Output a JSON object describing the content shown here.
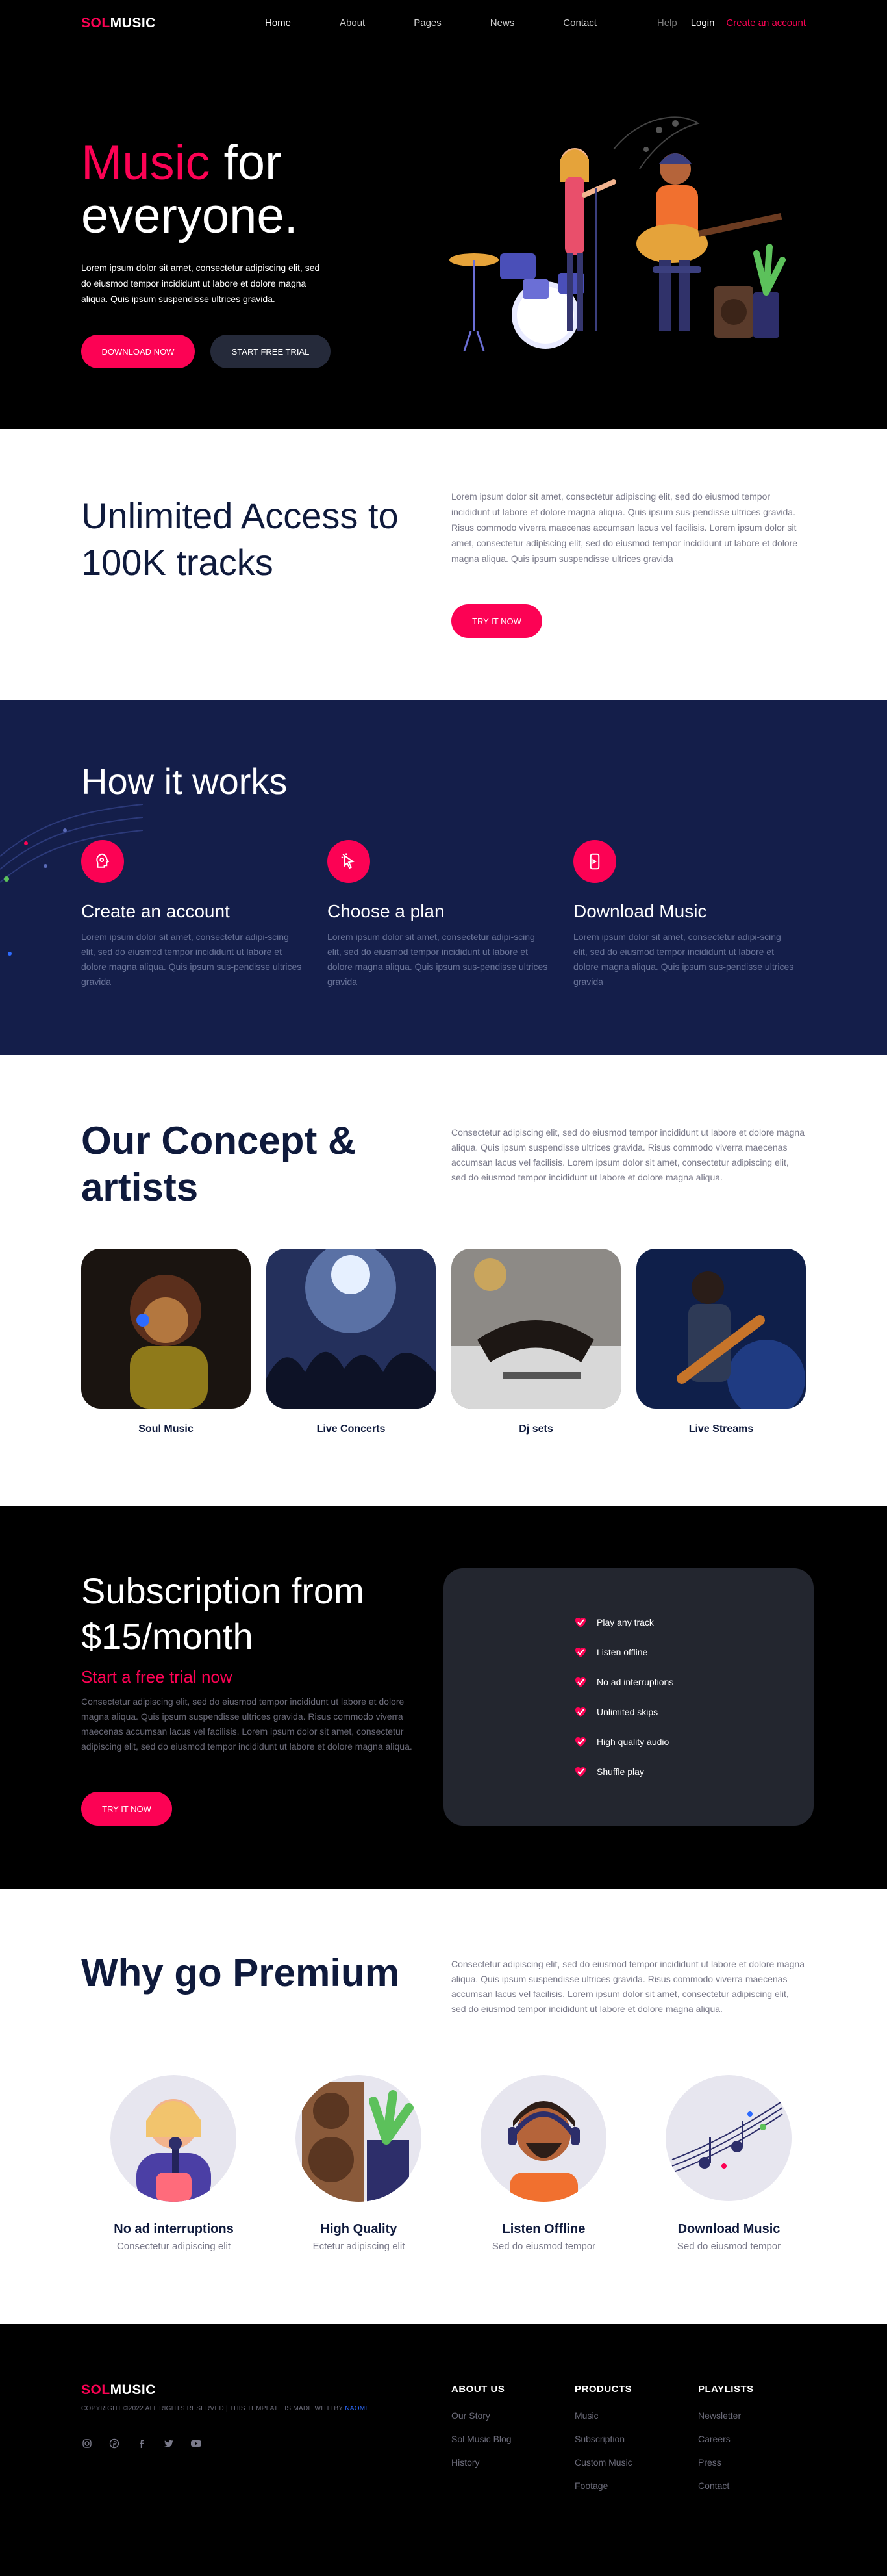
{
  "brand": {
    "logo_a": "SOL",
    "logo_b": "MUSIC",
    "accent": "#fc0254",
    "navy": "#0f1a3c",
    "how_bg": "#141e4a"
  },
  "nav": {
    "items": [
      {
        "label": "Home"
      },
      {
        "label": "About"
      },
      {
        "label": "Pages"
      },
      {
        "label": "News"
      },
      {
        "label": "Contact"
      }
    ],
    "help": "Help",
    "login": "Login",
    "create": "Create an account"
  },
  "hero": {
    "title_accent": "Music",
    "title_rest_1": " for",
    "title_rest_2": "everyone.",
    "text": "Lorem ipsum dolor sit amet, consectetur adipiscing elit, sed do eiusmod tempor incididunt ut labore et dolore magna aliqua. Quis ipsum suspendisse ultrices gravida.",
    "btn_download": "Download Now",
    "btn_trial": "Start free trial"
  },
  "access": {
    "title": "Unlimited Access to 100K tracks",
    "text": "Lorem ipsum dolor sit amet, consectetur adipiscing elit, sed do eiusmod tempor incididunt ut labore et dolore magna aliqua. Quis ipsum sus-pendisse ultrices gravida. Risus commodo viverra maecenas accumsan lacus vel facilisis. Lorem ipsum dolor sit amet, consectetur adipiscing elit, sed do eiusmod tempor incididunt ut labore et dolore magna aliqua. Quis ipsum suspendisse ultrices gravida",
    "btn": "Try it now"
  },
  "how": {
    "title": "How it works",
    "steps": [
      {
        "icon": "brain-icon",
        "title": "Create an account",
        "text": "Lorem ipsum dolor sit amet, consectetur adipi-scing elit, sed do eiusmod tempor incididunt ut labore et dolore magna aliqua. Quis ipsum sus-pendisse ultrices gravida"
      },
      {
        "icon": "cursor-icon",
        "title": "Choose a plan",
        "text": "Lorem ipsum dolor sit amet, consectetur adipi-scing elit, sed do eiusmod tempor incididunt ut labore et dolore magna aliqua. Quis ipsum sus-pendisse ultrices gravida"
      },
      {
        "icon": "phone-icon",
        "title": "Download Music",
        "text": "Lorem ipsum dolor sit amet, consectetur adipi-scing elit, sed do eiusmod tempor incididunt ut labore et dolore magna aliqua. Quis ipsum sus-pendisse ultrices gravida"
      }
    ]
  },
  "concept": {
    "title": "Our Concept & artists",
    "text": "Consectetur adipiscing elit, sed do eiusmod tempor incididunt ut labore et dolore magna aliqua. Quis ipsum suspendisse ultrices gravida. Risus commodo viverra maecenas accumsan lacus vel facilisis. Lorem ipsum dolor sit amet, consectetur adipiscing elit, sed do eiusmod tempor incididunt ut labore et dolore magna aliqua.",
    "cards": [
      {
        "label": "Soul Music"
      },
      {
        "label": "Live Concerts"
      },
      {
        "label": "Dj sets"
      },
      {
        "label": "Live Streams"
      }
    ]
  },
  "subscription": {
    "title": "Subscription from $15/month",
    "subtitle": "Start a free trial now",
    "text": "Consectetur adipiscing elit, sed do eiusmod tempor incididunt ut labore et dolore magna aliqua. Quis ipsum suspendisse ultrices gravida. Risus commodo viverra maecenas accumsan lacus vel facilisis. Lorem ipsum dolor sit amet, consectetur adipiscing elit, sed do eiusmod tempor incididunt ut labore et dolore magna aliqua.",
    "btn": "Try it now",
    "features": [
      "Play any track",
      "Listen offline",
      "No ad interruptions",
      "Unlimited skips",
      "High quality audio",
      "Shuffle play"
    ]
  },
  "premium": {
    "title": "Why go Premium",
    "text": "Consectetur adipiscing elit, sed do eiusmod tempor incididunt ut labore et dolore magna aliqua. Quis ipsum suspendisse ultrices gravida. Risus commodo viverra maecenas accumsan lacus vel facilisis. Lorem ipsum dolor sit amet, consectetur adipiscing elit, sed do eiusmod tempor incididunt ut labore et dolore magna aliqua.",
    "items": [
      {
        "title": "No ad interruptions",
        "sub": "Consectetur adipiscing elit"
      },
      {
        "title": "High Quality",
        "sub": "Ectetur adipiscing elit"
      },
      {
        "title": "Listen Offline",
        "sub": "Sed do eiusmod tempor"
      },
      {
        "title": "Download Music",
        "sub": "Sed do eiusmod tempor"
      }
    ]
  },
  "footer": {
    "copyright": "COPYRIGHT ©2022 ALL RIGHTS RESERVED | THIS TEMPLATE IS MADE WITH BY",
    "copyright_link": "NAOMI",
    "social": [
      "instagram-icon",
      "pinterest-icon",
      "facebook-icon",
      "twitter-icon",
      "youtube-icon"
    ],
    "columns": [
      {
        "title": "ABOUT US",
        "links": [
          "Our Story",
          "Sol Music Blog",
          "History"
        ]
      },
      {
        "title": "PRODUCTS",
        "links": [
          "Music",
          "Subscription",
          "Custom Music",
          "Footage"
        ]
      },
      {
        "title": "PLAYLISTS",
        "links": [
          "Newsletter",
          "Careers",
          "Press",
          "Contact"
        ]
      }
    ]
  }
}
